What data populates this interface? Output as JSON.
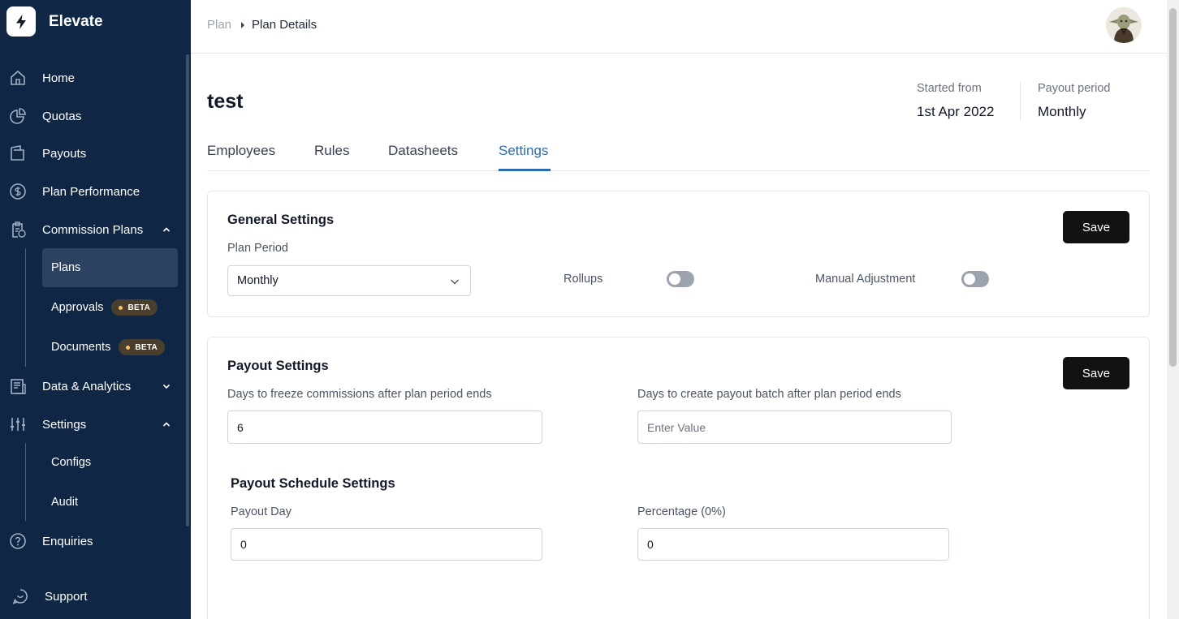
{
  "brand": {
    "name": "Elevate"
  },
  "sidebar": {
    "items": [
      {
        "label": "Home",
        "icon": "home-icon"
      },
      {
        "label": "Quotas",
        "icon": "pie-chart-icon"
      },
      {
        "label": "Payouts",
        "icon": "wallet-icon"
      },
      {
        "label": "Plan Performance",
        "icon": "dollar-circle-icon"
      },
      {
        "label": "Commission Plans",
        "icon": "clipboard-icon",
        "expanded": true
      },
      {
        "label": "Data & Analytics",
        "icon": "report-icon",
        "expanded": false
      },
      {
        "label": "Settings",
        "icon": "sliders-icon",
        "expanded": true
      },
      {
        "label": "Enquiries",
        "icon": "help-circle-icon"
      },
      {
        "label": "Support",
        "icon": "chat-icon"
      }
    ],
    "commission_sub": [
      {
        "label": "Plans",
        "active": true
      },
      {
        "label": "Approvals",
        "badge": "BETA"
      },
      {
        "label": "Documents",
        "badge": "BETA"
      }
    ],
    "settings_sub": [
      {
        "label": "Configs"
      },
      {
        "label": "Audit"
      }
    ]
  },
  "header": {
    "breadcrumb": {
      "root": "Plan",
      "current": "Plan Details"
    }
  },
  "plan": {
    "title": "test",
    "started_label": "Started from",
    "started_value": "1st Apr 2022",
    "payout_label": "Payout period",
    "payout_value": "Monthly"
  },
  "tabs": [
    {
      "label": "Employees"
    },
    {
      "label": "Rules"
    },
    {
      "label": "Datasheets"
    },
    {
      "label": "Settings",
      "active": true
    }
  ],
  "general": {
    "title": "General Settings",
    "save_label": "Save",
    "plan_period_label": "Plan Period",
    "plan_period_value": "Monthly",
    "rollups_label": "Rollups",
    "rollups_on": false,
    "manual_label": "Manual Adjustment",
    "manual_on": false
  },
  "payout": {
    "title": "Payout Settings",
    "save_label": "Save",
    "freeze_label": "Days to freeze commissions after plan period ends",
    "freeze_value": "6",
    "batch_label": "Days to create payout batch after plan period ends",
    "batch_placeholder": "Enter Value",
    "schedule_title": "Payout Schedule Settings",
    "day_label": "Payout Day",
    "day_value": "0",
    "pct_label": "Percentage (0%)",
    "pct_value": "0"
  },
  "colors": {
    "sidebar_bg": "#0f2744",
    "accent": "#2b6cb0",
    "button": "#121212"
  }
}
